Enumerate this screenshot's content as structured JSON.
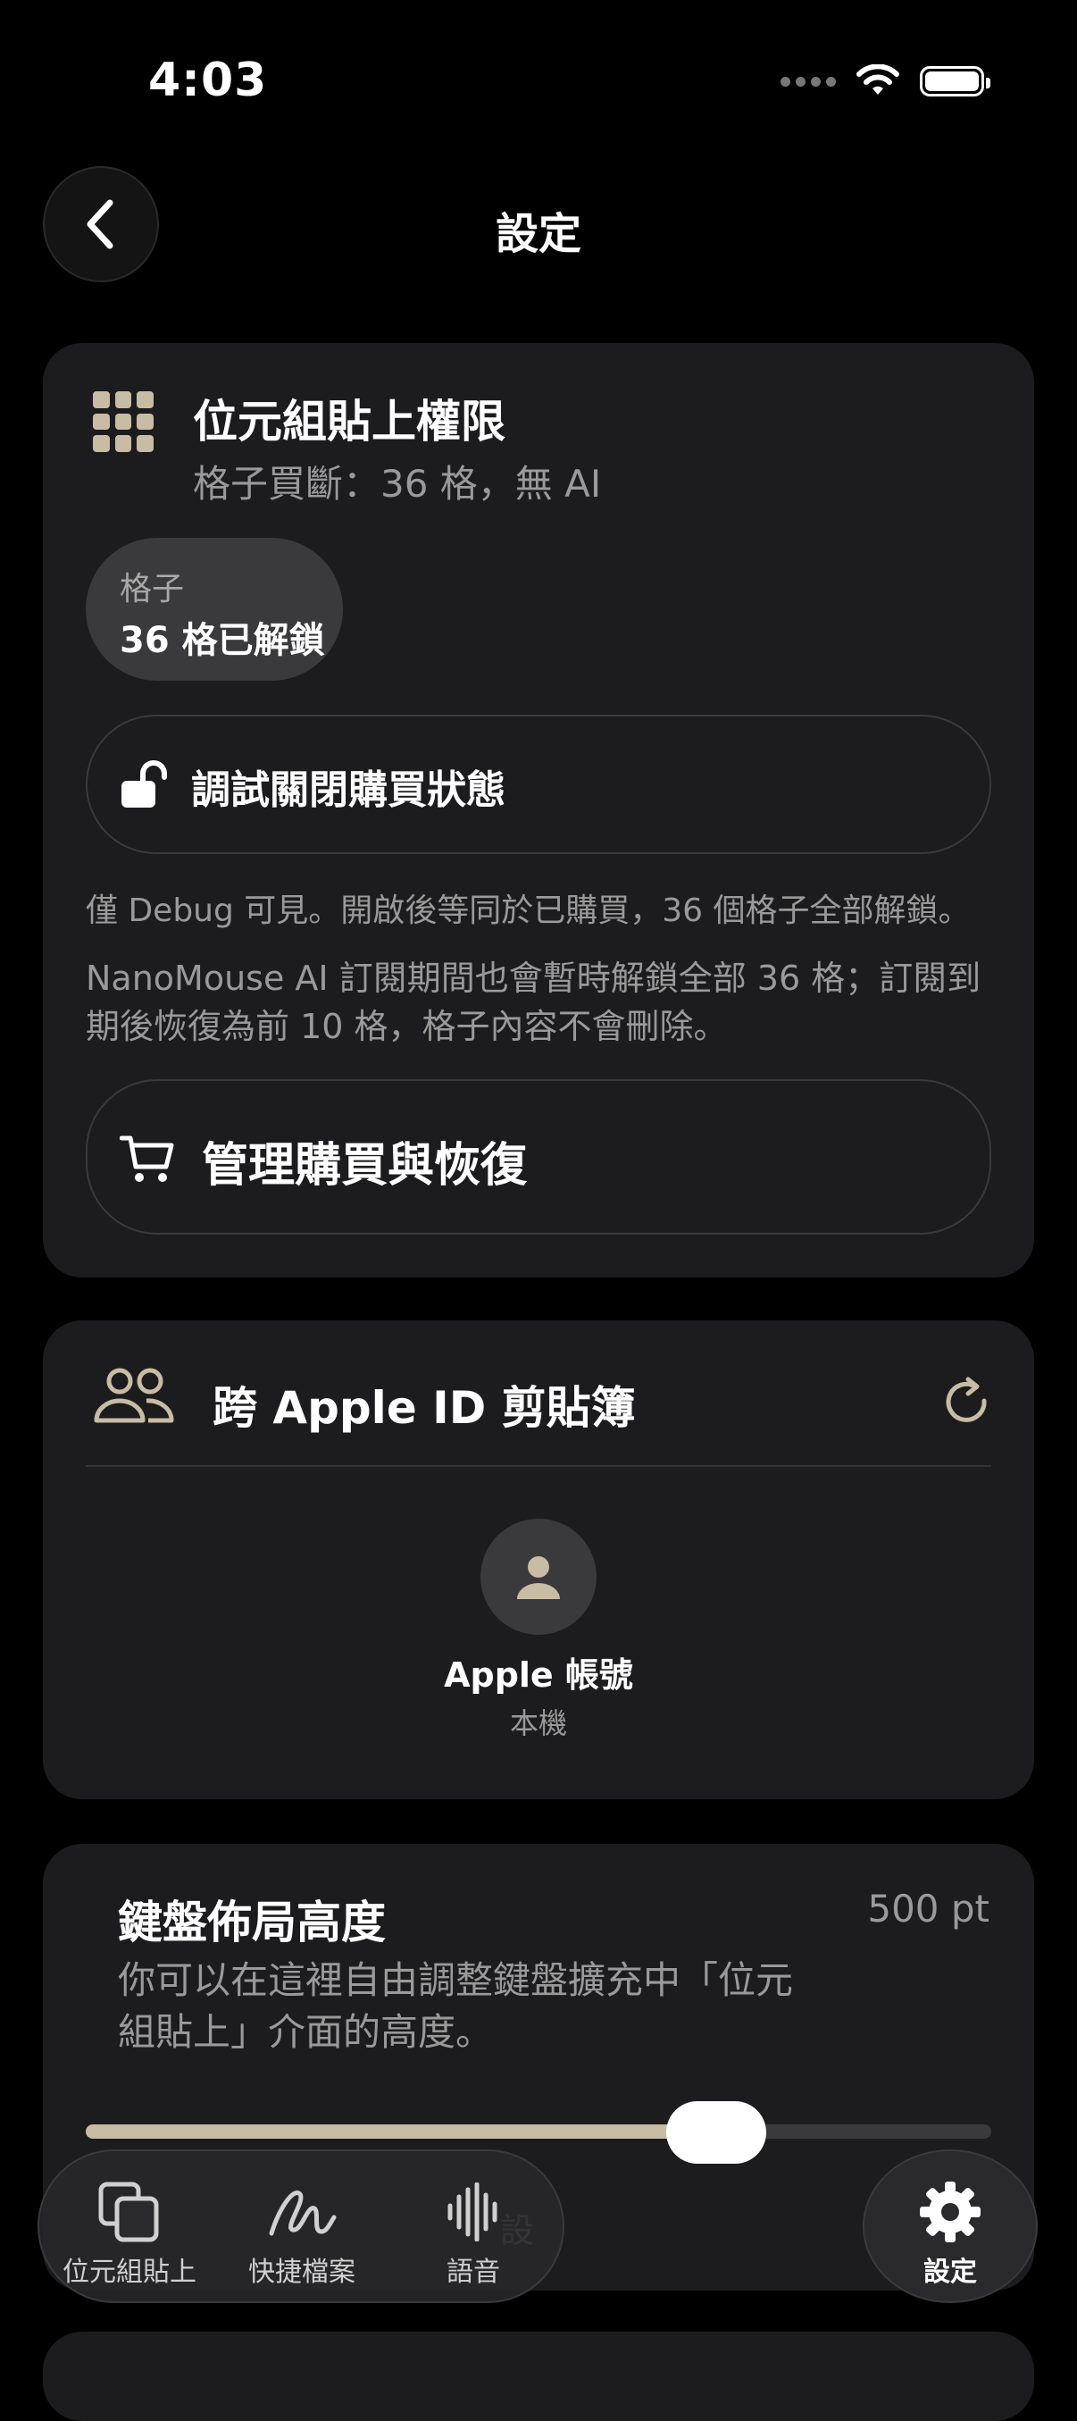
{
  "status_bar": {
    "time": "4:03"
  },
  "header": {
    "title": "設定"
  },
  "purchase_card": {
    "title": "位元組貼上權限",
    "subtitle": "格子買斷：36 格，無 AI",
    "chip": {
      "label": "格子",
      "value": "36 格已解鎖"
    },
    "debug_button_label": "調試關閉購買狀態",
    "note_debug": "僅 Debug 可見。開啟後等同於已購買，36 個格子全部解鎖。",
    "note_subscription": "NanoMouse AI 訂閱期間也會暫時解鎖全部 36 格；訂閱到期後恢復為前 10 格，格子內容不會刪除。",
    "manage_button_label": "管理購買與恢復"
  },
  "clipboard_card": {
    "title": "跨 Apple ID 剪貼簿",
    "account_name": "Apple 帳號",
    "account_sub": "本機"
  },
  "keyboard_card": {
    "title": "鍵盤佈局高度",
    "value": "500 pt",
    "description": "你可以在這裡自由調整鍵盤擴充中「位元組貼上」介面的高度。",
    "slider_fraction": 0.7,
    "peek_text": "設"
  },
  "tab_bar": {
    "tabs": [
      {
        "label": "位元組貼上",
        "icon": "copy-icon"
      },
      {
        "label": "快捷檔案",
        "icon": "scribble-icon"
      },
      {
        "label": "語音",
        "icon": "waveform-icon"
      }
    ],
    "settings_label": "設定"
  },
  "colors": {
    "accent": "#c8bca4",
    "card": "#1c1c1e",
    "background": "#000000"
  }
}
